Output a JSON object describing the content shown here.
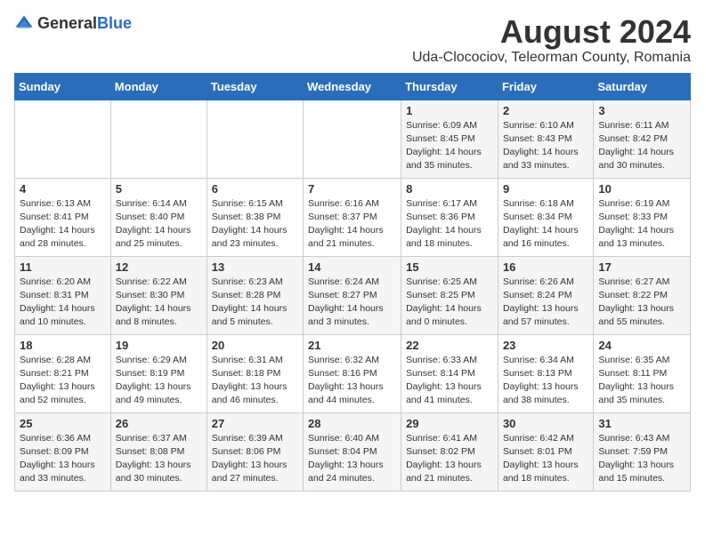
{
  "logo": {
    "general": "General",
    "blue": "Blue"
  },
  "title": "August 2024",
  "subtitle": "Uda-Clocociov, Teleorman County, Romania",
  "days_of_week": [
    "Sunday",
    "Monday",
    "Tuesday",
    "Wednesday",
    "Thursday",
    "Friday",
    "Saturday"
  ],
  "weeks": [
    [
      {
        "day": "",
        "info": ""
      },
      {
        "day": "",
        "info": ""
      },
      {
        "day": "",
        "info": ""
      },
      {
        "day": "",
        "info": ""
      },
      {
        "day": "1",
        "info": "Sunrise: 6:09 AM\nSunset: 8:45 PM\nDaylight: 14 hours\nand 35 minutes."
      },
      {
        "day": "2",
        "info": "Sunrise: 6:10 AM\nSunset: 8:43 PM\nDaylight: 14 hours\nand 33 minutes."
      },
      {
        "day": "3",
        "info": "Sunrise: 6:11 AM\nSunset: 8:42 PM\nDaylight: 14 hours\nand 30 minutes."
      }
    ],
    [
      {
        "day": "4",
        "info": "Sunrise: 6:13 AM\nSunset: 8:41 PM\nDaylight: 14 hours\nand 28 minutes."
      },
      {
        "day": "5",
        "info": "Sunrise: 6:14 AM\nSunset: 8:40 PM\nDaylight: 14 hours\nand 25 minutes."
      },
      {
        "day": "6",
        "info": "Sunrise: 6:15 AM\nSunset: 8:38 PM\nDaylight: 14 hours\nand 23 minutes."
      },
      {
        "day": "7",
        "info": "Sunrise: 6:16 AM\nSunset: 8:37 PM\nDaylight: 14 hours\nand 21 minutes."
      },
      {
        "day": "8",
        "info": "Sunrise: 6:17 AM\nSunset: 8:36 PM\nDaylight: 14 hours\nand 18 minutes."
      },
      {
        "day": "9",
        "info": "Sunrise: 6:18 AM\nSunset: 8:34 PM\nDaylight: 14 hours\nand 16 minutes."
      },
      {
        "day": "10",
        "info": "Sunrise: 6:19 AM\nSunset: 8:33 PM\nDaylight: 14 hours\nand 13 minutes."
      }
    ],
    [
      {
        "day": "11",
        "info": "Sunrise: 6:20 AM\nSunset: 8:31 PM\nDaylight: 14 hours\nand 10 minutes."
      },
      {
        "day": "12",
        "info": "Sunrise: 6:22 AM\nSunset: 8:30 PM\nDaylight: 14 hours\nand 8 minutes."
      },
      {
        "day": "13",
        "info": "Sunrise: 6:23 AM\nSunset: 8:28 PM\nDaylight: 14 hours\nand 5 minutes."
      },
      {
        "day": "14",
        "info": "Sunrise: 6:24 AM\nSunset: 8:27 PM\nDaylight: 14 hours\nand 3 minutes."
      },
      {
        "day": "15",
        "info": "Sunrise: 6:25 AM\nSunset: 8:25 PM\nDaylight: 14 hours\nand 0 minutes."
      },
      {
        "day": "16",
        "info": "Sunrise: 6:26 AM\nSunset: 8:24 PM\nDaylight: 13 hours\nand 57 minutes."
      },
      {
        "day": "17",
        "info": "Sunrise: 6:27 AM\nSunset: 8:22 PM\nDaylight: 13 hours\nand 55 minutes."
      }
    ],
    [
      {
        "day": "18",
        "info": "Sunrise: 6:28 AM\nSunset: 8:21 PM\nDaylight: 13 hours\nand 52 minutes."
      },
      {
        "day": "19",
        "info": "Sunrise: 6:29 AM\nSunset: 8:19 PM\nDaylight: 13 hours\nand 49 minutes."
      },
      {
        "day": "20",
        "info": "Sunrise: 6:31 AM\nSunset: 8:18 PM\nDaylight: 13 hours\nand 46 minutes."
      },
      {
        "day": "21",
        "info": "Sunrise: 6:32 AM\nSunset: 8:16 PM\nDaylight: 13 hours\nand 44 minutes."
      },
      {
        "day": "22",
        "info": "Sunrise: 6:33 AM\nSunset: 8:14 PM\nDaylight: 13 hours\nand 41 minutes."
      },
      {
        "day": "23",
        "info": "Sunrise: 6:34 AM\nSunset: 8:13 PM\nDaylight: 13 hours\nand 38 minutes."
      },
      {
        "day": "24",
        "info": "Sunrise: 6:35 AM\nSunset: 8:11 PM\nDaylight: 13 hours\nand 35 minutes."
      }
    ],
    [
      {
        "day": "25",
        "info": "Sunrise: 6:36 AM\nSunset: 8:09 PM\nDaylight: 13 hours\nand 33 minutes."
      },
      {
        "day": "26",
        "info": "Sunrise: 6:37 AM\nSunset: 8:08 PM\nDaylight: 13 hours\nand 30 minutes."
      },
      {
        "day": "27",
        "info": "Sunrise: 6:39 AM\nSunset: 8:06 PM\nDaylight: 13 hours\nand 27 minutes."
      },
      {
        "day": "28",
        "info": "Sunrise: 6:40 AM\nSunset: 8:04 PM\nDaylight: 13 hours\nand 24 minutes."
      },
      {
        "day": "29",
        "info": "Sunrise: 6:41 AM\nSunset: 8:02 PM\nDaylight: 13 hours\nand 21 minutes."
      },
      {
        "day": "30",
        "info": "Sunrise: 6:42 AM\nSunset: 8:01 PM\nDaylight: 13 hours\nand 18 minutes."
      },
      {
        "day": "31",
        "info": "Sunrise: 6:43 AM\nSunset: 7:59 PM\nDaylight: 13 hours\nand 15 minutes."
      }
    ]
  ]
}
